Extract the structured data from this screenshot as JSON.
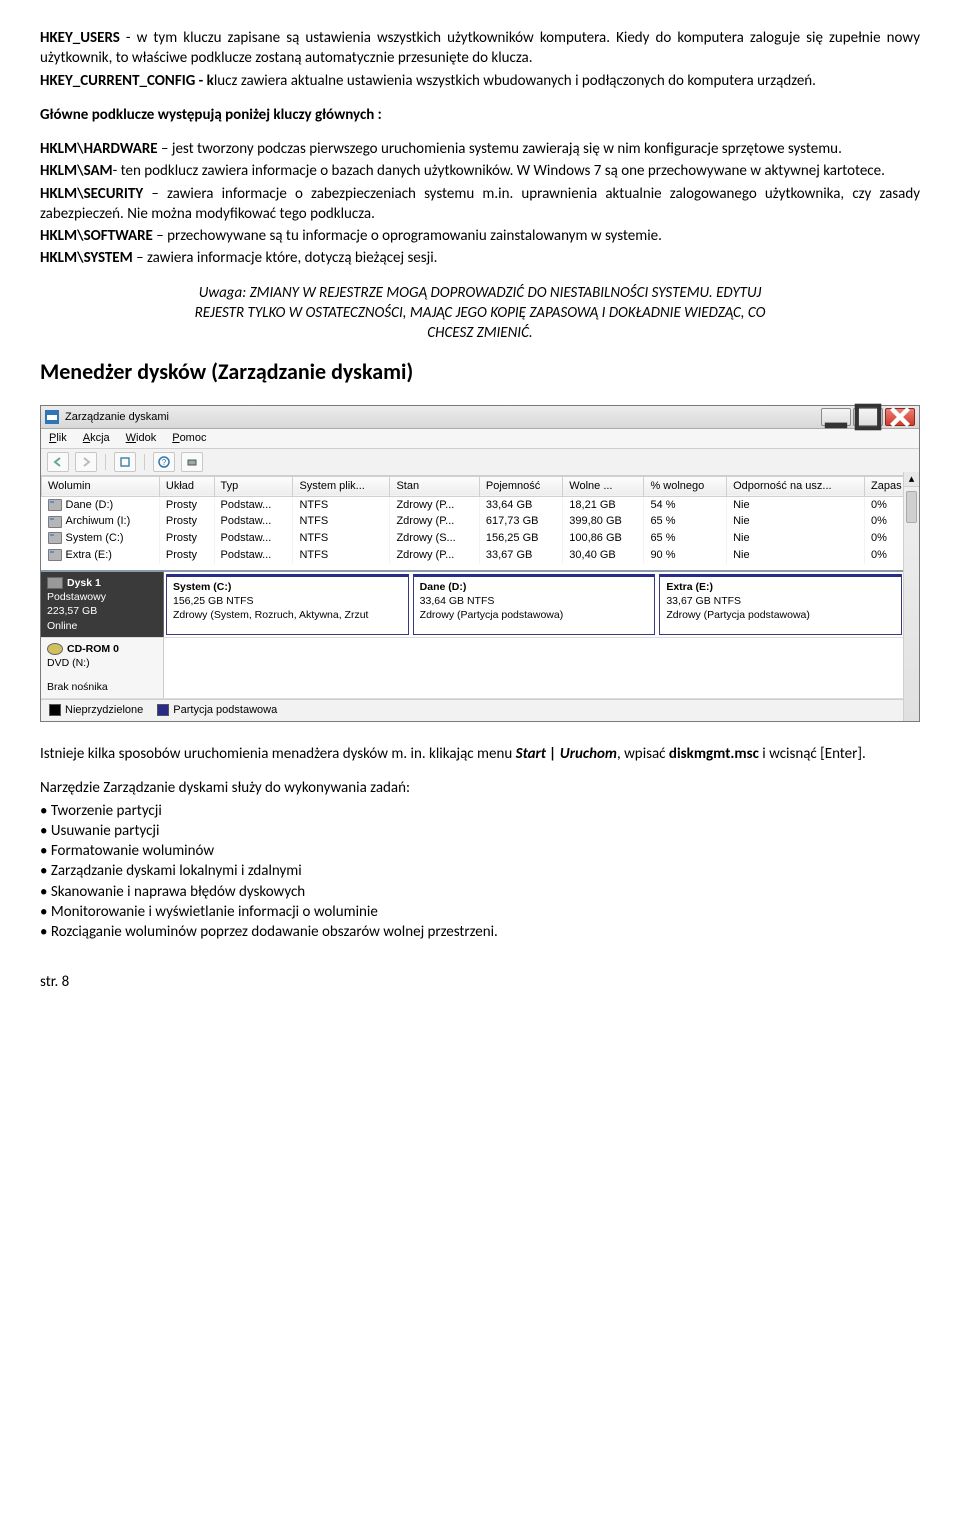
{
  "text": {
    "hkey_users_label": "HKEY_USERS",
    "hkey_users_desc": " - w tym kluczu zapisane są ustawienia wszystkich użytkowników komputera. Kiedy do komputera zaloguje się zupełnie nowy użytkownik, to właściwe podklucze zostaną automatycznie przesunięte do klucza.",
    "hkey_cc_label": "HKEY_CURRENT_CONFIG - k",
    "hkey_cc_desc": "lucz zawiera aktualne ustawienia wszystkich wbudowanych i podłączonych do komputera urządzeń.",
    "subkeys_heading": "Główne podklucze występują poniżej kluczy głównych :",
    "hklm_hw_label": "HKLM\\HARDWARE",
    "hklm_hw_desc": " – jest tworzony podczas pierwszego uruchomienia systemu zawierają się w nim konfiguracje sprzętowe systemu.",
    "hklm_sam_label": "HKLM\\SAM",
    "hklm_sam_desc": "- ten podklucz zawiera informacje o bazach danych użytkowników. W Windows 7 są one przechowywane w aktywnej kartotece.",
    "hklm_sec_label": "HKLM\\SECURITY",
    "hklm_sec_desc": " – zawiera informacje o zabezpieczeniach systemu m.in. uprawnienia aktualnie zalogowanego użytkownika, czy zasady zabezpieczeń. Nie można modyfikować tego podklucza.",
    "hklm_sw_label": "HKLM\\SOFTWARE",
    "hklm_sw_desc": " – przechowywane są tu informacje o oprogramowaniu zainstalowanym w systemie.",
    "hklm_sys_label": "HKLM\\SYSTEM",
    "hklm_sys_desc": " – zawiera informacje które, dotyczą bieżącej sesji.",
    "warning_l1": "Uwaga: ZMIANY W REJESTRZE MOGĄ DOPROWADZIĆ DO NIESTABILNOŚCI SYSTEMU. EDYTUJ",
    "warning_l2": "REJESTR TYLKO W OSTATECZNOŚCI, MAJĄC JEGO KOPIĘ ZAPASOWĄ I DOKŁADNIE WIEDZĄC, CO",
    "warning_l3": "CHCESZ ZMIENIĆ.",
    "section_title": "Menedżer dysków (Zarządzanie dyskami)",
    "after_screenshot_1a": "Istnieje kilka sposobów uruchomienia menadżera dysków m. in. klikając menu ",
    "after_screenshot_1b": "Start | Uruchom",
    "after_screenshot_1c": ", wpisać ",
    "after_screenshot_1d": "diskmgmt.msc",
    "after_screenshot_1e": " i wcisnąć [Enter].",
    "tasks_heading": "Narzędzie Zarządzanie dyskami służy do wykonywania zadań:",
    "tasks": [
      "Tworzenie partycji",
      "Usuwanie partycji",
      "Formatowanie woluminów",
      "Zarządzanie dyskami lokalnymi i zdalnymi",
      "Skanowanie i naprawa błędów dyskowych",
      "Monitorowanie i wyświetlanie informacji o woluminie",
      "Rozciąganie woluminów poprzez dodawanie obszarów wolnej przestrzeni."
    ],
    "page_num": "str. 8"
  },
  "dm": {
    "title": "Zarządzanie dyskami",
    "menu": [
      "Plik",
      "Akcja",
      "Widok",
      "Pomoc"
    ],
    "columns": [
      "Wolumin",
      "Układ",
      "Typ",
      "System plik...",
      "Stan",
      "Pojemność",
      "Wolne ...",
      "% wolnego",
      "Odporność na usz...",
      "Zapas"
    ],
    "rows": [
      {
        "v": "Dane (D:)",
        "u": "Prosty",
        "t": "Podstaw...",
        "fs": "NTFS",
        "st": "Zdrowy (P...",
        "cap": "33,64 GB",
        "free": "18,21 GB",
        "pct": "54 %",
        "ft": "Nie",
        "ov": "0%"
      },
      {
        "v": "Archiwum (I:)",
        "u": "Prosty",
        "t": "Podstaw...",
        "fs": "NTFS",
        "st": "Zdrowy (P...",
        "cap": "617,73 GB",
        "free": "399,80 GB",
        "pct": "65 %",
        "ft": "Nie",
        "ov": "0%"
      },
      {
        "v": "System (C:)",
        "u": "Prosty",
        "t": "Podstaw...",
        "fs": "NTFS",
        "st": "Zdrowy (S...",
        "cap": "156,25 GB",
        "free": "100,86 GB",
        "pct": "65 %",
        "ft": "Nie",
        "ov": "0%"
      },
      {
        "v": "Extra (E:)",
        "u": "Prosty",
        "t": "Podstaw...",
        "fs": "NTFS",
        "st": "Zdrowy (P...",
        "cap": "33,67 GB",
        "free": "30,40 GB",
        "pct": "90 %",
        "ft": "Nie",
        "ov": "0%"
      }
    ],
    "disk1": {
      "name": "Dysk 1",
      "type": "Podstawowy",
      "size": "223,57 GB",
      "status": "Online",
      "parts": [
        {
          "title": "System  (C:)",
          "line2": "156,25 GB NTFS",
          "line3": "Zdrowy (System, Rozruch, Aktywna, Zrzut"
        },
        {
          "title": "Dane  (D:)",
          "line2": "33,64 GB NTFS",
          "line3": "Zdrowy (Partycja podstawowa)"
        },
        {
          "title": "Extra  (E:)",
          "line2": "33,67 GB NTFS",
          "line3": "Zdrowy (Partycja podstawowa)"
        }
      ]
    },
    "cd": {
      "name": "CD-ROM 0",
      "line2": "DVD (N:)",
      "line3": "Brak nośnika"
    },
    "legend": {
      "unalloc": "Nieprzydzielone",
      "primary": "Partycja podstawowa"
    }
  }
}
